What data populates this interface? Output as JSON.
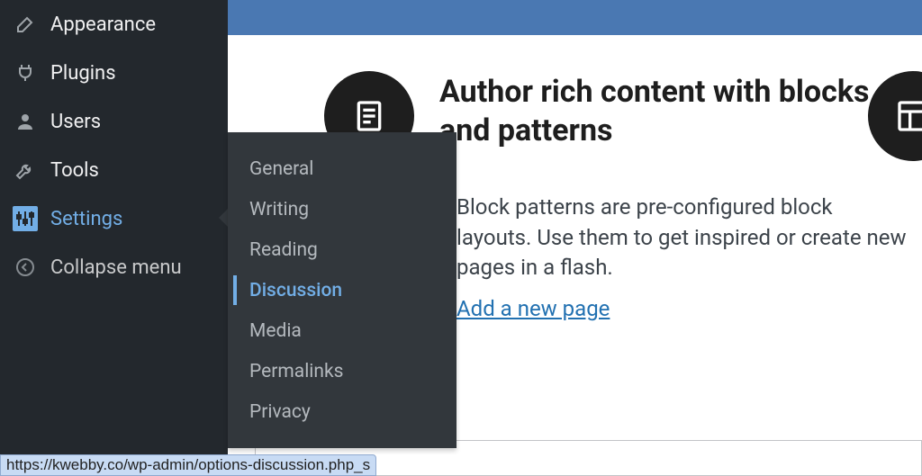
{
  "sidebar": {
    "items": [
      {
        "label": "Appearance"
      },
      {
        "label": "Plugins"
      },
      {
        "label": "Users"
      },
      {
        "label": "Tools"
      },
      {
        "label": "Settings"
      },
      {
        "label": "Collapse menu"
      }
    ]
  },
  "submenu": {
    "items": [
      {
        "label": "General"
      },
      {
        "label": "Writing"
      },
      {
        "label": "Reading"
      },
      {
        "label": "Discussion"
      },
      {
        "label": "Media"
      },
      {
        "label": "Permalinks"
      },
      {
        "label": "Privacy"
      }
    ],
    "current_index": 3
  },
  "content": {
    "heading": "Author rich content with blocks and patterns",
    "paragraph": "Block patterns are pre-configured block layouts. Use them to get inspired or create new pages in a flash.",
    "link_text": "Add a new page"
  },
  "statusbar": {
    "url": "https://kwebby.co/wp-admin/options-discussion.php_s"
  },
  "colors": {
    "sidebar_bg": "#23282d",
    "submenu_bg": "#32373c",
    "accent": "#72aee6",
    "link": "#2271b1",
    "bluebar": "#4a78b2"
  }
}
